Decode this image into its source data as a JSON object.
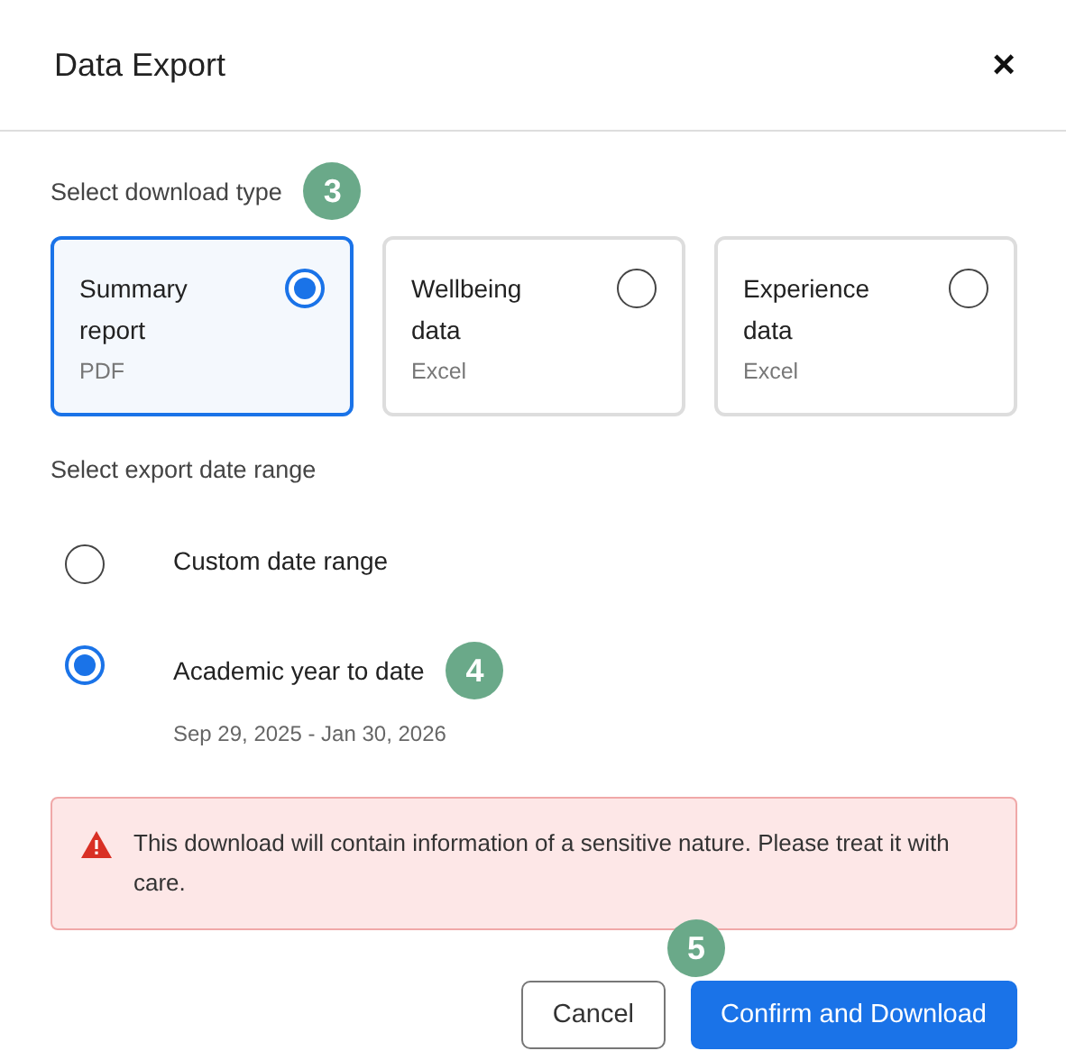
{
  "dialog": {
    "title": "Data Export",
    "close": "×"
  },
  "download_type": {
    "label": "Select download type",
    "badge": "3",
    "options": [
      {
        "title": "Summary report",
        "format": "PDF",
        "selected": true
      },
      {
        "title": "Wellbeing data",
        "format": "Excel",
        "selected": false
      },
      {
        "title": "Experience data",
        "format": "Excel",
        "selected": false
      }
    ]
  },
  "date_range": {
    "label": "Select export date range",
    "badge": "4",
    "options": [
      {
        "title": "Custom date range",
        "selected": false
      },
      {
        "title": "Academic year to date",
        "detail": "Sep 29, 2025 - Jan 30, 2026",
        "selected": true
      }
    ]
  },
  "alert": {
    "text": "This download will contain information of a sensitive nature. Please treat it with care."
  },
  "footer": {
    "badge": "5",
    "buttons": [
      {
        "label": "Cancel",
        "kind": "secondary"
      },
      {
        "label": "Confirm and Download",
        "kind": "primary"
      }
    ]
  }
}
